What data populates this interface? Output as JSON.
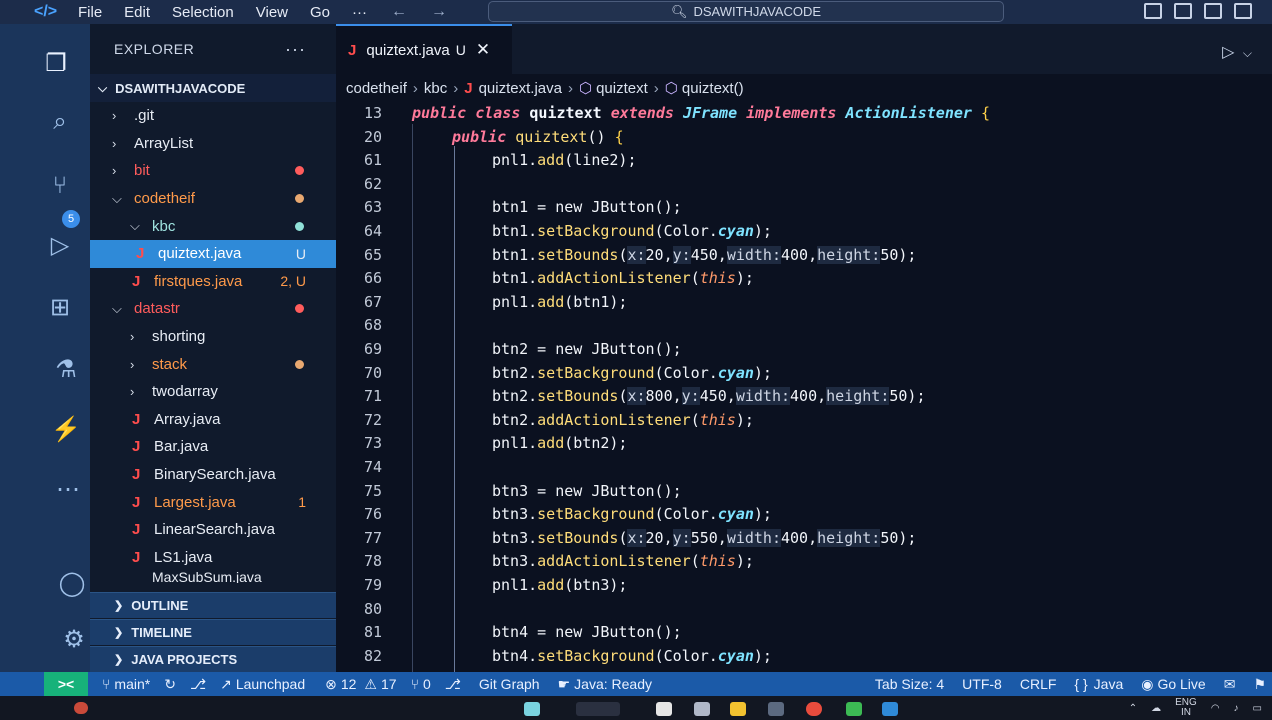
{
  "menubar": {
    "items": [
      "File",
      "Edit",
      "Selection",
      "View",
      "Go",
      "···"
    ],
    "back": "←",
    "forward": "→",
    "search": "DSAWITHJAVACODE"
  },
  "explorer": {
    "title": "EXPLORER",
    "more": "···",
    "root": "DSAWITHJAVACODE",
    "items": [
      {
        "label": ".git",
        "type": "folder",
        "depth": 0,
        "expanded": false,
        "color": "white",
        "status": ""
      },
      {
        "label": "ArrayList",
        "type": "folder",
        "depth": 0,
        "expanded": false,
        "color": "white",
        "status": ""
      },
      {
        "label": "bit",
        "type": "folder",
        "depth": 0,
        "expanded": false,
        "color": "red",
        "status": "",
        "dot": "#ff5c5c"
      },
      {
        "label": "codetheif",
        "type": "folder",
        "depth": 0,
        "expanded": true,
        "color": "orange",
        "status": "",
        "dot": "#e8a870"
      },
      {
        "label": "kbc",
        "type": "folder",
        "depth": 1,
        "expanded": true,
        "color": "teal",
        "status": "",
        "dot": "#8fe0d8"
      },
      {
        "label": "quiztext.java",
        "type": "file",
        "depth": 2,
        "color": "white",
        "status": "U",
        "selected": true
      },
      {
        "label": "firstques.java",
        "type": "file",
        "depth": 1,
        "color": "orange",
        "status": "2, U"
      },
      {
        "label": "datastr",
        "type": "folder",
        "depth": 0,
        "expanded": true,
        "color": "red",
        "status": "",
        "dot": "#ff5c5c"
      },
      {
        "label": "shorting",
        "type": "folder",
        "depth": 1,
        "expanded": false,
        "color": "white",
        "status": ""
      },
      {
        "label": "stack",
        "type": "folder",
        "depth": 1,
        "expanded": false,
        "color": "orange",
        "status": "",
        "dot": "#e8a870"
      },
      {
        "label": "twodarray",
        "type": "folder",
        "depth": 1,
        "expanded": false,
        "color": "white",
        "status": ""
      },
      {
        "label": "Array.java",
        "type": "file",
        "depth": 1,
        "color": "white",
        "status": ""
      },
      {
        "label": "Bar.java",
        "type": "file",
        "depth": 1,
        "color": "white",
        "status": ""
      },
      {
        "label": "BinarySearch.java",
        "type": "file",
        "depth": 1,
        "color": "white",
        "status": ""
      },
      {
        "label": "Largest.java",
        "type": "file",
        "depth": 1,
        "color": "orange",
        "status": "1"
      },
      {
        "label": "LinearSearch.java",
        "type": "file",
        "depth": 1,
        "color": "white",
        "status": ""
      },
      {
        "label": "LS1.java",
        "type": "file",
        "depth": 1,
        "color": "white",
        "status": ""
      }
    ],
    "partial_item": "MaxSubSum.java",
    "sections": [
      "OUTLINE",
      "TIMELINE",
      "JAVA PROJECTS"
    ]
  },
  "editor": {
    "tab": {
      "label": "quiztext.java",
      "modified": "U",
      "close": "✕"
    },
    "breadcrumb": [
      "codetheif",
      "kbc",
      "quiztext.java",
      "quiztext",
      "quiztext()"
    ],
    "lines": [
      {
        "n": "13",
        "indent": 0,
        "tokens": [
          [
            "kw",
            "public "
          ],
          [
            "kw",
            "class "
          ],
          [
            "cls2",
            "quiztext "
          ],
          [
            "kw",
            "extends "
          ],
          [
            "cls",
            "JFrame "
          ],
          [
            "kw",
            "implements "
          ],
          [
            "cls",
            "ActionListener "
          ],
          [
            "brace",
            "{"
          ]
        ]
      },
      {
        "n": "20",
        "indent": 1,
        "tokens": [
          [
            "kw",
            "public "
          ],
          [
            "fn",
            "quiztext"
          ],
          [
            "pl",
            "() "
          ],
          [
            "brace",
            "{"
          ]
        ]
      },
      {
        "n": "61",
        "indent": 2,
        "tokens": [
          [
            "pl",
            "pnl1."
          ],
          [
            "fn",
            "add"
          ],
          [
            "pl",
            "(line2);"
          ]
        ]
      },
      {
        "n": "62",
        "indent": 2,
        "tokens": []
      },
      {
        "n": "63",
        "indent": 2,
        "tokens": [
          [
            "pl",
            "btn1 = "
          ],
          [
            "pl",
            "new "
          ],
          [
            "pl",
            "JButton();"
          ]
        ]
      },
      {
        "n": "64",
        "indent": 2,
        "tokens": [
          [
            "pl",
            "btn1."
          ],
          [
            "fn",
            "setBackground"
          ],
          [
            "pl",
            "(Color."
          ],
          [
            "cls",
            "cyan"
          ],
          [
            "pl",
            ");"
          ]
        ]
      },
      {
        "n": "65",
        "indent": 2,
        "tokens": [
          [
            "pl",
            "btn1."
          ],
          [
            "fn",
            "setBounds"
          ],
          [
            "pl",
            "("
          ],
          [
            "hint",
            "x:"
          ],
          [
            "pl",
            "20,"
          ],
          [
            "hint",
            "y:"
          ],
          [
            "pl",
            "450,"
          ],
          [
            "hint",
            "width:"
          ],
          [
            "pl",
            "400,"
          ],
          [
            "hint",
            "height:"
          ],
          [
            "pl",
            "50);"
          ]
        ]
      },
      {
        "n": "66",
        "indent": 2,
        "tokens": [
          [
            "pl",
            "btn1."
          ],
          [
            "fn",
            "addActionListener"
          ],
          [
            "pl",
            "("
          ],
          [
            "this",
            "this"
          ],
          [
            "pl",
            ");"
          ]
        ]
      },
      {
        "n": "67",
        "indent": 2,
        "tokens": [
          [
            "pl",
            "pnl1."
          ],
          [
            "fn",
            "add"
          ],
          [
            "pl",
            "(btn1);"
          ]
        ]
      },
      {
        "n": "68",
        "indent": 2,
        "tokens": []
      },
      {
        "n": "69",
        "indent": 2,
        "tokens": [
          [
            "pl",
            "btn2 = "
          ],
          [
            "pl",
            "new "
          ],
          [
            "pl",
            "JButton();"
          ]
        ]
      },
      {
        "n": "70",
        "indent": 2,
        "tokens": [
          [
            "pl",
            "btn2."
          ],
          [
            "fn",
            "setBackground"
          ],
          [
            "pl",
            "(Color."
          ],
          [
            "cls",
            "cyan"
          ],
          [
            "pl",
            ");"
          ]
        ]
      },
      {
        "n": "71",
        "indent": 2,
        "tokens": [
          [
            "pl",
            "btn2."
          ],
          [
            "fn",
            "setBounds"
          ],
          [
            "pl",
            "("
          ],
          [
            "hint",
            "x:"
          ],
          [
            "pl",
            "800,"
          ],
          [
            "hint",
            "y:"
          ],
          [
            "pl",
            "450,"
          ],
          [
            "hint",
            "width:"
          ],
          [
            "pl",
            "400,"
          ],
          [
            "hint",
            "height:"
          ],
          [
            "pl",
            "50);"
          ]
        ]
      },
      {
        "n": "72",
        "indent": 2,
        "tokens": [
          [
            "pl",
            "btn2."
          ],
          [
            "fn",
            "addActionListener"
          ],
          [
            "pl",
            "("
          ],
          [
            "this",
            "this"
          ],
          [
            "pl",
            ");"
          ]
        ]
      },
      {
        "n": "73",
        "indent": 2,
        "tokens": [
          [
            "pl",
            "pnl1."
          ],
          [
            "fn",
            "add"
          ],
          [
            "pl",
            "(btn2);"
          ]
        ]
      },
      {
        "n": "74",
        "indent": 2,
        "tokens": []
      },
      {
        "n": "75",
        "indent": 2,
        "tokens": [
          [
            "pl",
            "btn3 = "
          ],
          [
            "pl",
            "new "
          ],
          [
            "pl",
            "JButton();"
          ]
        ]
      },
      {
        "n": "76",
        "indent": 2,
        "tokens": [
          [
            "pl",
            "btn3."
          ],
          [
            "fn",
            "setBackground"
          ],
          [
            "pl",
            "(Color."
          ],
          [
            "cls",
            "cyan"
          ],
          [
            "pl",
            ");"
          ]
        ]
      },
      {
        "n": "77",
        "indent": 2,
        "tokens": [
          [
            "pl",
            "btn3."
          ],
          [
            "fn",
            "setBounds"
          ],
          [
            "pl",
            "("
          ],
          [
            "hint",
            "x:"
          ],
          [
            "pl",
            "20,"
          ],
          [
            "hint",
            "y:"
          ],
          [
            "pl",
            "550,"
          ],
          [
            "hint",
            "width:"
          ],
          [
            "pl",
            "400,"
          ],
          [
            "hint",
            "height:"
          ],
          [
            "pl",
            "50);"
          ]
        ]
      },
      {
        "n": "78",
        "indent": 2,
        "tokens": [
          [
            "pl",
            "btn3."
          ],
          [
            "fn",
            "addActionListener"
          ],
          [
            "pl",
            "("
          ],
          [
            "this",
            "this"
          ],
          [
            "pl",
            ");"
          ]
        ]
      },
      {
        "n": "79",
        "indent": 2,
        "tokens": [
          [
            "pl",
            "pnl1."
          ],
          [
            "fn",
            "add"
          ],
          [
            "pl",
            "(btn3);"
          ]
        ]
      },
      {
        "n": "80",
        "indent": 2,
        "tokens": []
      },
      {
        "n": "81",
        "indent": 2,
        "tokens": [
          [
            "pl",
            "btn4 = "
          ],
          [
            "pl",
            "new "
          ],
          [
            "pl",
            "JButton();"
          ]
        ]
      },
      {
        "n": "82",
        "indent": 2,
        "tokens": [
          [
            "pl",
            "btn4."
          ],
          [
            "fn",
            "setBackground"
          ],
          [
            "pl",
            "(Color."
          ],
          [
            "cls",
            "cyan"
          ],
          [
            "pl",
            ");"
          ]
        ]
      }
    ]
  },
  "statusbar": {
    "branch": "main*",
    "launchpad": "Launchpad",
    "errors": "12",
    "warnings": "17",
    "ports": "0",
    "git_graph": "Git Graph",
    "java_status": "Java: Ready",
    "tab_size": "Tab Size: 4",
    "encoding": "UTF-8",
    "eol": "CRLF",
    "language": "Java",
    "go_live": "Go Live"
  },
  "taskbar": {
    "lang_top": "ENG",
    "lang_bottom": "IN"
  },
  "colors": {
    "accent": "#3b8eea",
    "statusbar": "#1b5aa8",
    "activitybar": "#1b355b"
  }
}
